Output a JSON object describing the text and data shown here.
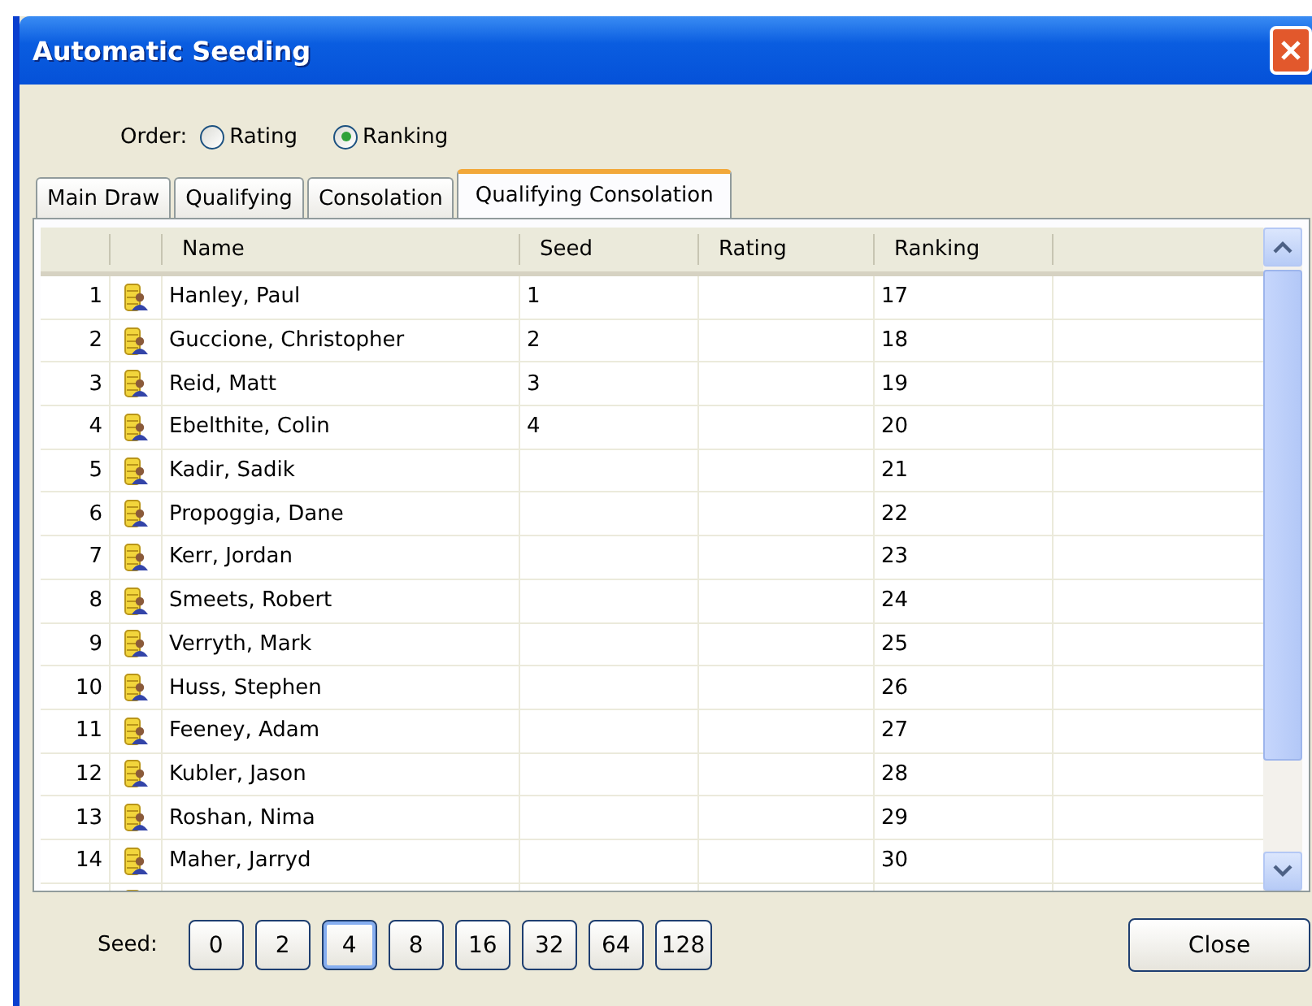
{
  "window": {
    "title": "Automatic Seeding"
  },
  "order": {
    "label": "Order:",
    "options": [
      {
        "label": "Rating",
        "selected": false
      },
      {
        "label": "Ranking",
        "selected": true
      }
    ]
  },
  "tabs": [
    {
      "label": "Main Draw",
      "selected": false
    },
    {
      "label": "Qualifying",
      "selected": false
    },
    {
      "label": "Consolation",
      "selected": false
    },
    {
      "label": "Qualifying Consolation",
      "selected": true
    }
  ],
  "table": {
    "columns": [
      "Name",
      "Seed",
      "Rating",
      "Ranking"
    ],
    "rows": [
      {
        "index": "1",
        "name": "Hanley, Paul",
        "seed": "1",
        "rating": "",
        "ranking": "17"
      },
      {
        "index": "2",
        "name": "Guccione, Christopher",
        "seed": "2",
        "rating": "",
        "ranking": "18"
      },
      {
        "index": "3",
        "name": "Reid, Matt",
        "seed": "3",
        "rating": "",
        "ranking": "19"
      },
      {
        "index": "4",
        "name": "Ebelthite, Colin",
        "seed": "4",
        "rating": "",
        "ranking": "20"
      },
      {
        "index": "5",
        "name": "Kadir, Sadik",
        "seed": "",
        "rating": "",
        "ranking": "21"
      },
      {
        "index": "6",
        "name": "Propoggia, Dane",
        "seed": "",
        "rating": "",
        "ranking": "22"
      },
      {
        "index": "7",
        "name": "Kerr, Jordan",
        "seed": "",
        "rating": "",
        "ranking": "23"
      },
      {
        "index": "8",
        "name": "Smeets, Robert",
        "seed": "",
        "rating": "",
        "ranking": "24"
      },
      {
        "index": "9",
        "name": "Verryth, Mark",
        "seed": "",
        "rating": "",
        "ranking": "25"
      },
      {
        "index": "10",
        "name": "Huss, Stephen",
        "seed": "",
        "rating": "",
        "ranking": "26"
      },
      {
        "index": "11",
        "name": "Feeney, Adam",
        "seed": "",
        "rating": "",
        "ranking": "27"
      },
      {
        "index": "12",
        "name": "Kubler, Jason",
        "seed": "",
        "rating": "",
        "ranking": "28"
      },
      {
        "index": "13",
        "name": "Roshan, Nima",
        "seed": "",
        "rating": "",
        "ranking": "29"
      },
      {
        "index": "14",
        "name": "Maher, Jarryd",
        "seed": "",
        "rating": "",
        "ranking": "30"
      }
    ]
  },
  "seed_bar": {
    "label": "Seed:",
    "options": [
      {
        "label": "0",
        "selected": false
      },
      {
        "label": "2",
        "selected": false
      },
      {
        "label": "4",
        "selected": true
      },
      {
        "label": "8",
        "selected": false
      },
      {
        "label": "16",
        "selected": false
      },
      {
        "label": "32",
        "selected": false
      },
      {
        "label": "64",
        "selected": false
      },
      {
        "label": "128",
        "selected": false
      }
    ]
  },
  "buttons": [
    "Close"
  ]
}
